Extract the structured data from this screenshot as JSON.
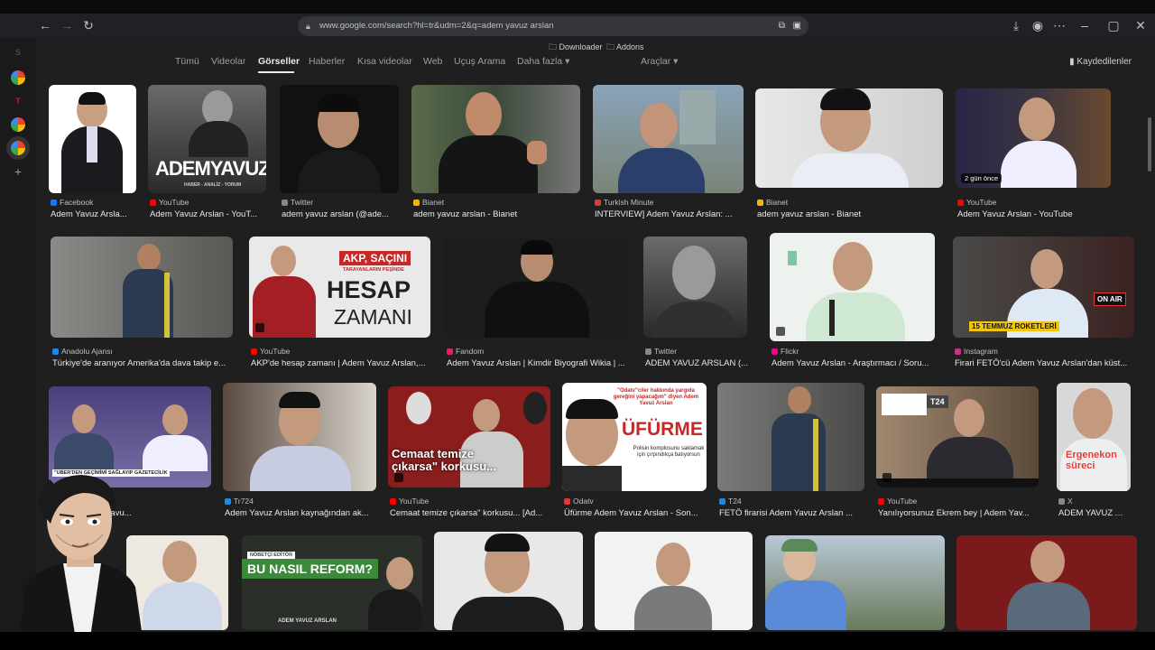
{
  "browser": {
    "url": "www.google.com/search?hl=tr&udm=2&q=adem yavuz arslan",
    "bookmarks": [
      "Downloader",
      "Addons"
    ]
  },
  "sidebar": {
    "letter": "S"
  },
  "search_tabs": [
    "Tümü",
    "Videolar",
    "Görseller",
    "Haberler",
    "Kısa videolar",
    "Web",
    "Uçuş Arama",
    "Daha fazla",
    "Araçlar"
  ],
  "saved_label": "Kaydedilenler",
  "results": [
    {
      "source": "Facebook",
      "caption": "Adem Yavuz Arsla...",
      "color": "#1877f2"
    },
    {
      "source": "YouTube",
      "caption": "Adem Yavuz Arslan - YouT...",
      "color": "#ff0000"
    },
    {
      "source": "Twitter",
      "caption": "adem yavuz arslan (@ade...",
      "color": "#888888"
    },
    {
      "source": "Bianet",
      "caption": "adem yavuz arslan - Bianet",
      "color": "#f5b400"
    },
    {
      "source": "Turkish Minute",
      "caption": "INTERVIEW] Adem Yavuz Arslan: ...",
      "color": "#e53935"
    },
    {
      "source": "Bianet",
      "caption": "adem yavuz arslan - Bianet",
      "color": "#f5b400"
    },
    {
      "source": "YouTube",
      "caption": "Adem Yavuz Arslan - YouTube",
      "color": "#ff0000"
    },
    {
      "source": "Anadolu Ajansı",
      "caption": "Türkiye'de aranıyor Amerika'da dava takip e...",
      "color": "#1e88e5"
    },
    {
      "source": "YouTube",
      "caption": "AKP'de hesap zamanı | Adem Yavuz Arslan,...",
      "color": "#ff0000"
    },
    {
      "source": "Fandom",
      "caption": "Adem Yavuz Arslan | Kimdir Biyografi Wikia | ...",
      "color": "#e91e63"
    },
    {
      "source": "Twitter",
      "caption": "ADEM YAVUZ ARSLAN (...",
      "color": "#888888"
    },
    {
      "source": "Flickr",
      "caption": "Adem Yavuz Arslan - Araştırmacı / Soru...",
      "color": "#ff0084"
    },
    {
      "source": "Instagram",
      "caption": "Firari FETÖ'cü Adem Yavuz Arslan'dan küst...",
      "color": "#c13584"
    },
    {
      "source": "",
      "caption": "ETÖ'cü Adem Yavu...",
      "color": "#888888"
    },
    {
      "source": "Tr724",
      "caption": "Adem Yavuz Arslan kaynağından ak...",
      "color": "#1e88e5"
    },
    {
      "source": "YouTube",
      "caption": "Cemaat temize çıkarsa\" korkusu... [Ad...",
      "color": "#ff0000"
    },
    {
      "source": "Odatv",
      "caption": "Üfürme Adem Yavuz Arslan - Son...",
      "color": "#e53935"
    },
    {
      "source": "T24",
      "caption": "FETÖ firarisi Adem Yavuz Arslan ...",
      "color": "#1e88e5"
    },
    {
      "source": "YouTube",
      "caption": "Yanılıyorsunuz Ekrem bey | Adem Yav...",
      "color": "#ff0000"
    },
    {
      "source": "X",
      "caption": "ADEM YAVUZ AR...",
      "color": "#888888"
    }
  ],
  "overlays": {
    "ademyavuz": "ADEMYAVUZ",
    "ademyavuz_sub": "HABER - ANALİZ - YORUM",
    "akp": "AKP, SAÇINI",
    "akp_sub": "TARAYANLARIN PEŞİNDE",
    "hesap": "HESAP",
    "zamani": "ZAMANI",
    "ago": "2 gün önce",
    "onair": "ON AIR",
    "temmuz": "15 TEMMUZ ROKETLERİ",
    "ufurme": "ÜFÜRME",
    "odatv_quote": "\"Odatv\"ciler hakkında yargıda gereğini yapacağım\" diyen Adem Yavuz Arslan",
    "odatv_sub": "Polisin komplosunu saklamak için çırpındıkça batıyorsun",
    "cemaat": "Cemaat temize çıkarsa\" korkusu...",
    "ergenekon": "Ergenekon süreci",
    "reform": "BU NASIL REFORM?",
    "nobetci": "NÖBETÇİ EDİTÖR",
    "adem_footer": "ADEM YAVUZ ARSLAN",
    "geçim": "\"UBER'DEN GEÇİMİMİ SAĞLAYIP GAZETECİLİK",
    "t724": "T24"
  }
}
